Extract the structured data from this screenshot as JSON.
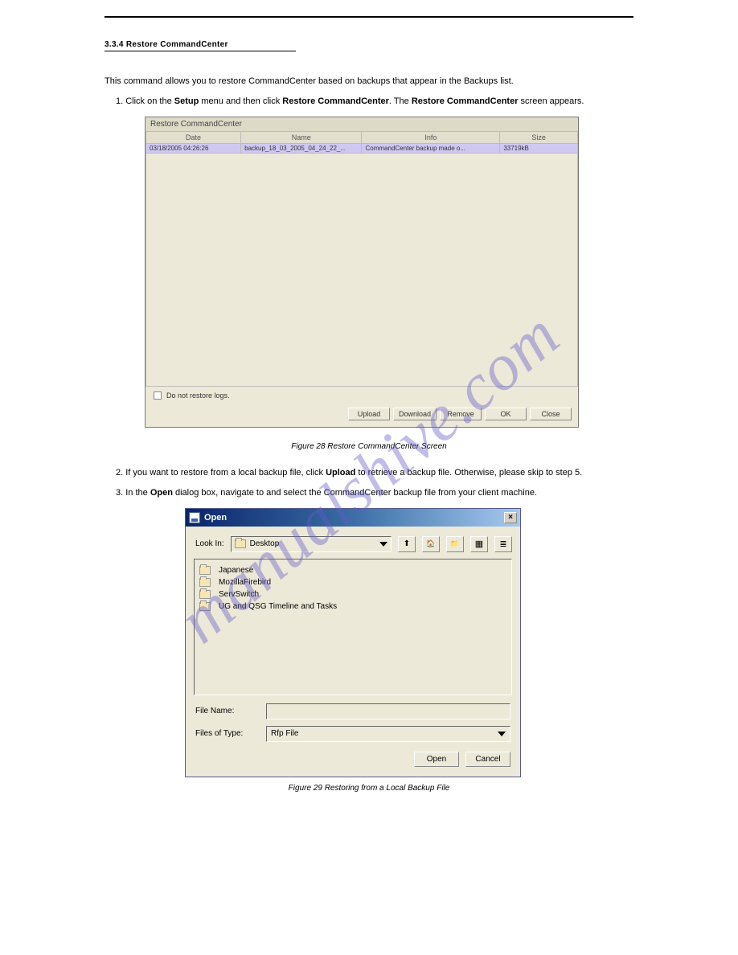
{
  "header": {
    "section_number": "3.3.4 Restore CommandCenter"
  },
  "intro_text": "This command allows you to restore CommandCenter based on backups that appear in the Backups list.",
  "step_1": "1. Click on the ",
  "step_1_bold_a": "Setup",
  "step_1_mid_a": " menu and then click ",
  "step_1_bold_b": "Restore CommandCenter",
  "step_1_mid_b": ". The ",
  "step_1_bold_c": "Restore CommandCenter",
  "step_1_end": " screen appears.",
  "restore_dialog": {
    "title": "Restore CommandCenter",
    "columns": {
      "date": "Date",
      "name": "Name",
      "info": "Info",
      "size": "Size"
    },
    "row": {
      "date": "03/18/2005 04:26:26",
      "name": "backup_18_03_2005_04_24_22_...",
      "info": "CommandCenter backup made o...",
      "size": "33719kB"
    },
    "checkbox_label": "Do not restore logs.",
    "buttons": {
      "upload": "Upload",
      "download": "Download",
      "remove": "Remove",
      "ok": "OK",
      "close": "Close"
    }
  },
  "fig1_caption": "Figure 28 Restore CommandCenter Screen",
  "step_2": "2. If you want to restore from a local backup file, click ",
  "step_2_bold": "Upload",
  "step_2_end": " to retrieve a backup file. Otherwise, please skip to step 5.",
  "step_3": "3. In the ",
  "step_3_bold": "Open",
  "step_3_end": " dialog box, navigate to and select the CommandCenter backup file from your client machine.",
  "open_dialog": {
    "title": "Open",
    "look_in_label": "Look In:",
    "look_in_value": "Desktop",
    "items": [
      "Japanese",
      "MozillaFirebird",
      "ServSwitch",
      "UG and QSG Timeline and Tasks"
    ],
    "file_name_label": "File Name:",
    "file_name_value": "",
    "files_of_type_label": "Files of Type:",
    "files_of_type_value": "Rfp File",
    "buttons": {
      "open": "Open",
      "cancel": "Cancel"
    }
  },
  "fig2_caption": "Figure 29 Restoring from a Local Backup File",
  "watermark": "manualshive.com"
}
